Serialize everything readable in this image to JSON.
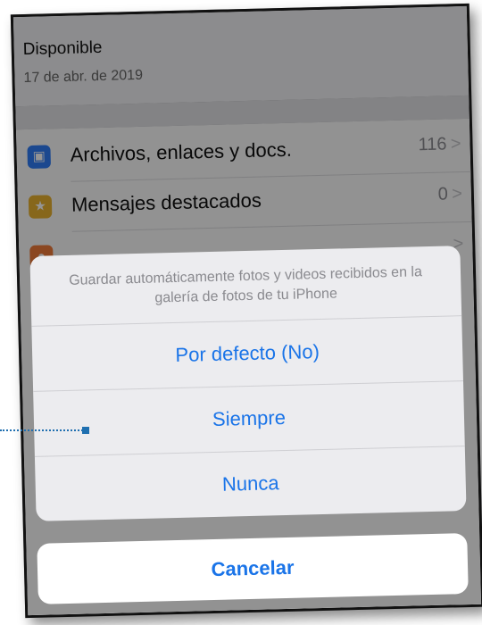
{
  "header": {
    "title": "Disponible",
    "date": "17 de abr. de 2019"
  },
  "list": {
    "rows": [
      {
        "label": "Archivos, enlaces y docs.",
        "count": "116",
        "chevron": ">",
        "icon": "photo-icon",
        "color": "#2f7cf6"
      },
      {
        "label": "Mensajes destacados",
        "count": "0",
        "chevron": ">",
        "icon": "star-icon",
        "color": "#e8b130"
      },
      {
        "label": "",
        "count": "",
        "chevron": ">",
        "icon": "search-icon",
        "color": "#ef7b3a"
      }
    ]
  },
  "action_sheet": {
    "message": "Guardar automáticamente fotos y videos recibidos en la galería de fotos de tu iPhone",
    "options": [
      "Por defecto (No)",
      "Siempre",
      "Nunca"
    ],
    "cancel": "Cancelar",
    "accent": "#1a74e8"
  },
  "annotation": {
    "color": "#1f6fb0"
  }
}
